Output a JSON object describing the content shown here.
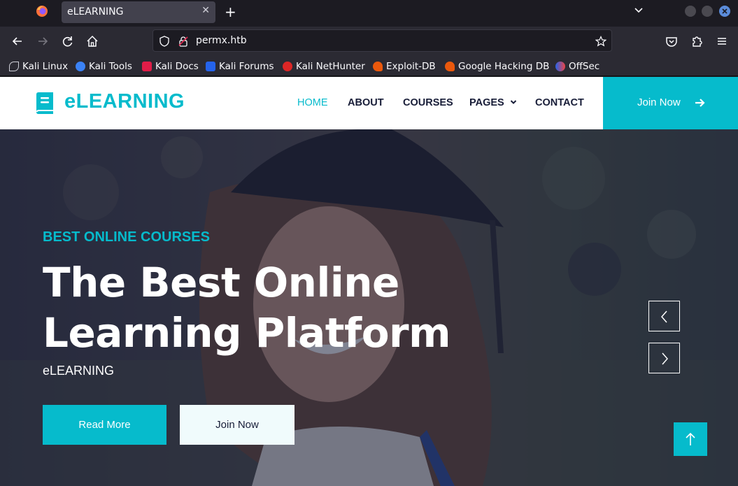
{
  "browser": {
    "tab_title": "eLEARNING",
    "url": "permx.htb",
    "bookmarks": [
      {
        "label": "Kali Linux",
        "icon": "kali-dragon-icon",
        "color": "#cfcfd8"
      },
      {
        "label": "Kali Tools",
        "icon": "kali-tools-icon",
        "color": "#3b82f6"
      },
      {
        "label": "Kali Docs",
        "icon": "kali-docs-icon",
        "color": "#e11d48"
      },
      {
        "label": "Kali Forums",
        "icon": "kali-forums-icon",
        "color": "#2563eb"
      },
      {
        "label": "Kali NetHunter",
        "icon": "kali-nethunter-icon",
        "color": "#dc2626"
      },
      {
        "label": "Exploit-DB",
        "icon": "exploit-db-icon",
        "color": "#ea580c"
      },
      {
        "label": "Google Hacking DB",
        "icon": "ghdb-icon",
        "color": "#ea580c"
      },
      {
        "label": "OffSec",
        "icon": "offsec-icon",
        "color": "#6366f1"
      }
    ]
  },
  "site": {
    "brand": "eLEARNING",
    "accent_color": "#06bbcc",
    "dark_color": "#181d38",
    "menu": [
      {
        "label": "HOME",
        "active": true
      },
      {
        "label": "ABOUT",
        "active": false
      },
      {
        "label": "COURSES",
        "active": false
      },
      {
        "label": "PAGES",
        "active": false
      },
      {
        "label": "CONTACT",
        "active": false
      }
    ],
    "join_cta": "Join Now"
  },
  "hero": {
    "kicker": "BEST ONLINE COURSES",
    "title": "The Best Online Learning Platform",
    "subtitle": "eLEARNING",
    "read_more": "Read More",
    "join_now": "Join Now"
  }
}
